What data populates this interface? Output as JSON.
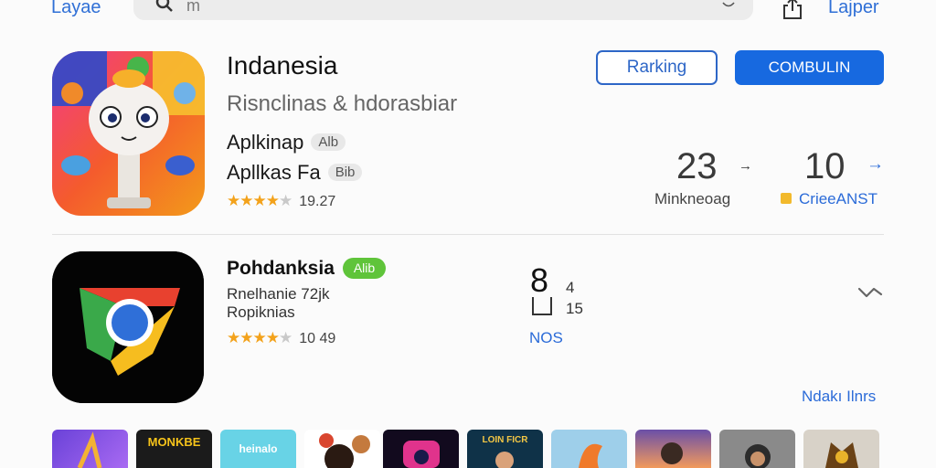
{
  "topbar": {
    "back_label": "Layae",
    "search_text": "m",
    "right_label": "Lajper"
  },
  "app1": {
    "title": "Indanesia",
    "subtitle": "Risnclinas & hdorasbiar",
    "line1": "Aplkinap",
    "line1_badge": "Alb",
    "line2": "Apllkas Fa",
    "line2_badge": "Bib",
    "rating_value": "19.27",
    "rating_stars": 4,
    "ranking_button": "Rarking",
    "primary_button": "COMBULIN",
    "stat1_value": "23",
    "stat1_label": "Minkneoag",
    "stat2_value": "10",
    "stat2_label": "CrieeANST",
    "arrow": "→"
  },
  "app2": {
    "title": "Pohdanksia",
    "badge": "Alib",
    "line1": "Rnelhanie 72jk",
    "line2": "Ropiknias",
    "rating_value": "10 49",
    "rating_stars": 4,
    "mid_big": "8",
    "mid_small1": "4",
    "mid_small2": "15",
    "mid_link": "NOS",
    "more_link": "Ndakı Ilnrs"
  },
  "tiles": [
    {
      "name": "tile-purple",
      "text": ""
    },
    {
      "name": "tile-poster-yellow",
      "text": "MONKBE"
    },
    {
      "name": "tile-cyan",
      "text": "heinalo"
    },
    {
      "name": "tile-character",
      "text": ""
    },
    {
      "name": "tile-dark-game",
      "text": ""
    },
    {
      "name": "tile-movie",
      "text": "LOIN FICR"
    },
    {
      "name": "tile-sky",
      "text": ""
    },
    {
      "name": "tile-portrait",
      "text": ""
    },
    {
      "name": "tile-person",
      "text": ""
    },
    {
      "name": "tile-warrior",
      "text": ""
    }
  ],
  "colors": {
    "accent": "#1769e0",
    "star": "#f3a21b",
    "green_badge": "#5fc43a"
  }
}
